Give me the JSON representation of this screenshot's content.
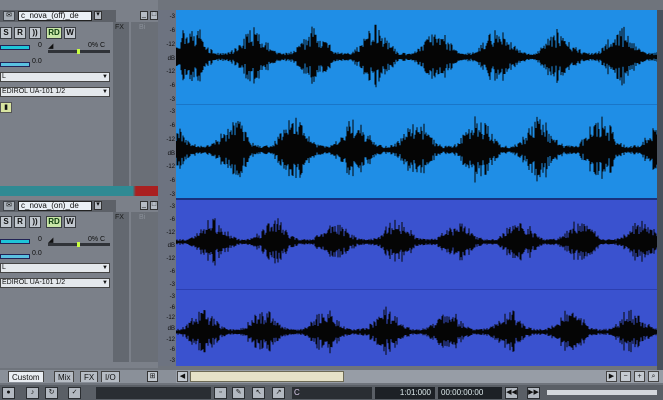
{
  "tracks": [
    {
      "name": "c_nova_(off)_de",
      "icon": "✉",
      "solo": "S",
      "rec": "R",
      "io": "))",
      "rd": "RD",
      "w": "W",
      "vol_value": "0",
      "pan_value": "0% C",
      "trim_value": "0.0",
      "input": "L",
      "output": "EDIROL UA-101 1/2",
      "fx_label": "FX",
      "fx_placeholder": "Bi",
      "vol_level": 0.62
    },
    {
      "name": "c_nova_(on)_de",
      "icon": "✉",
      "solo": "S",
      "rec": "R",
      "io": "))",
      "rd": "RD",
      "w": "W",
      "vol_value": "0",
      "pan_value": "0% C",
      "trim_value": "0.0",
      "input": "L",
      "output": "EDIROL UA-101 1/2",
      "fx_label": "FX",
      "fx_placeholder": "Bi",
      "vol_level": 0.62
    }
  ],
  "scale_labels": [
    "-3",
    "-6",
    "-12",
    "dB",
    "-12",
    "-6",
    "-3"
  ],
  "tabs": [
    "Custom",
    "Mix",
    "FX",
    "I/O"
  ],
  "transport": {
    "time": "1:01:000",
    "time2": "00:00:00:00"
  },
  "colors": {
    "lane_top": "#1f8ee6",
    "lane_bottom": "#3a52cf",
    "wave": "#050505"
  }
}
